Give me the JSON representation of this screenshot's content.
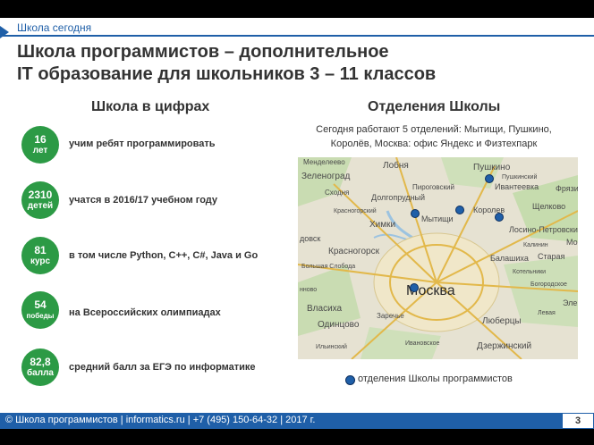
{
  "header": {
    "section": "Школа сегодня",
    "title_line1": "Школа программистов – дополнительное",
    "title_line2": "IT образование для школьников 3 – 11 классов"
  },
  "left": {
    "heading": "Школа в цифрах",
    "stats": [
      {
        "num": "16",
        "unit": "лет",
        "text": "учим ребят программировать"
      },
      {
        "num": "2310",
        "unit": "детей",
        "text": "учатся в 2016/17 учебном году"
      },
      {
        "num": "81",
        "unit": "курс",
        "text": "в том числе Python, C++, C#, Java и Go"
      },
      {
        "num": "54",
        "unit": "победы",
        "text": "на Всероссийских олимпиадах"
      },
      {
        "num": "82,8",
        "unit": "балла",
        "text": "средний балл за ЕГЭ по информатике"
      }
    ]
  },
  "right": {
    "heading": "Отделения Школы",
    "desc_line1": "Сегодня работают 5 отделений: Мытищи, Пушкино,",
    "desc_line2": "Королёв, Москва: офис Яндекс и Физтехпарк",
    "legend": "отделения Школы программистов",
    "map_labels": {
      "mendeleevo": "Менделеево",
      "lobnya": "Лобня",
      "pushkino": "Пушкино",
      "zelenograd": "Зеленоград",
      "pirogovsky": "Пироговский",
      "ivanteevka": "Ивантеевка",
      "fryazino": "Фрязи",
      "skhodnya": "Сходня",
      "dolgoprudny": "Долгопрудный",
      "korolev": "Королев",
      "shchelkovo": "Щелково",
      "khimki": "Химки",
      "mytishchi": "Мытищи",
      "losino": "Лосино-Петровский",
      "dedovsk": "довск",
      "krasnogorsk": "Красногорск",
      "balashikha": "Балашиха",
      "starayakupavna": "Старая",
      "moskva": "Москва",
      "elektro": "Элe",
      "vlasikha": "Власиха",
      "odintsovo": "Одинцово",
      "zarechye": "Заречье",
      "lyubertsy": "Люберцы",
      "dzerzhinsky": "Дзержинский",
      "kotelniki": "Котельники",
      "ilinsky": "Ильинский",
      "bolshaya": "Большая Слобода",
      "kalinin": "Калинин",
      "pushkinsky": "Пушкинский",
      "krasnogorsky": "Красногорский",
      "bogorodskoe": "Богородское",
      "levaya": "Левая",
      "moskva2": "Мо",
      "nnovo": "нново",
      "ivanovo": "Ивановское"
    }
  },
  "footer": {
    "text": "© Школа программистов  |  informatics.ru  |  +7 (495) 150-64-32  |  2017 г.",
    "page": "3"
  },
  "colors": {
    "accent": "#1f5fa8",
    "badge": "#2c9a45"
  },
  "icons": {
    "legend": "map-marker-dot"
  }
}
